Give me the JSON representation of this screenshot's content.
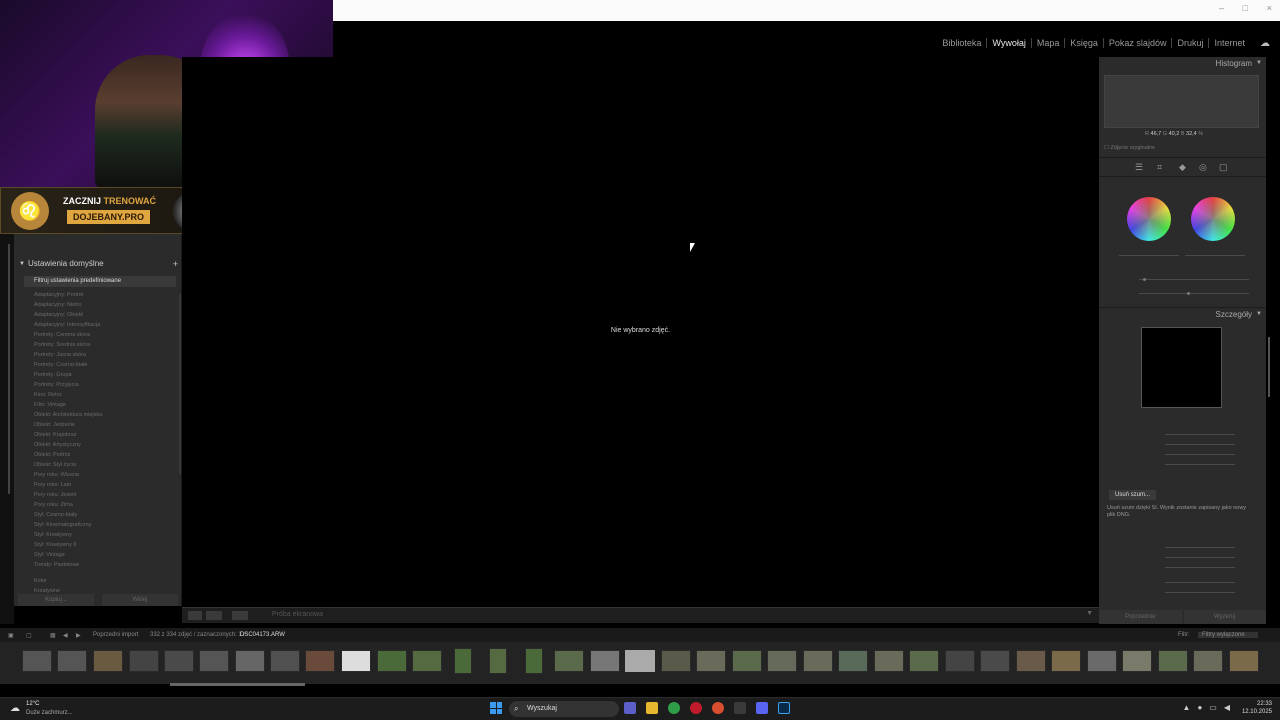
{
  "overlay": {
    "banner_line1_prefix": "ZACZNIJ",
    "banner_line1_accent": "TRENOWAĆ",
    "banner_line2": "DOJEBANY.PRO"
  },
  "window_controls": [
    "–",
    "□",
    "×"
  ],
  "modules": [
    "Biblioteka",
    "Wywołaj",
    "Mapa",
    "Księga",
    "Pokaz slajdów",
    "Drukuj",
    "Internet"
  ],
  "active_module": "Wywołaj",
  "left_panel": {
    "presets_header": "Ustawienia domyślne",
    "filter_label": "Filtruj ustawienia predefiniowane",
    "preset_groups": [
      "Adaptacyjny: Portret",
      "Adaptacyjny: Niebo",
      "Adaptacyjny: Obiekt",
      "Adaptacyjny: Intensyfikacja",
      "Portrety: Ciemna skóra",
      "Portrety: Średnia skóra",
      "Portrety: Jasna skóra",
      "Portrety: Czarno-białe",
      "Portrety: Grupa",
      "Portrety: Przyjęcia",
      "Kino: Retro",
      "Film: Vintage",
      "Obiekt: Architektura miejska",
      "Obiekt: Jedzenie",
      "Obiekt: Krajobraz",
      "Obiekt: Artystyczny",
      "Obiekt: Podróż",
      "Obiekt: Styl życia",
      "Pory roku: Wiosna",
      "Pory roku: Lato",
      "Pory roku: Jesień",
      "Pory roku: Zima",
      "Styl: Czarno-biały",
      "Styl: Kinematograficzny",
      "Styl: Kreatywny",
      "Styl: Kreatywny II",
      "Styl: Vintage",
      "Trendy: Pastelowe",
      "Kolor",
      "Kreatywne"
    ],
    "btn_import": "Kopiuj...",
    "btn_reset": "Wklej"
  },
  "center": {
    "message": "Nie wybrano zdjęć."
  },
  "toolbar": {
    "label": "Próba ekranowa"
  },
  "right_panel": {
    "histogram_title": "Histogram",
    "rgb": {
      "r_label": "R",
      "r": "46,7",
      "g_label": "G",
      "g": "40,2",
      "b_label": "B",
      "b": "32,4",
      "unit": "%"
    },
    "original_label": "Zdjęcie oryginalne",
    "details_title": "Szczegóły",
    "denoise_button": "Usuń szum...",
    "denoise_text": "Usuń szum dzięki SI. Wynik zostanie zapisany jako nowy plik DNG.",
    "btn_prev": "Poprzednie",
    "btn_reset": "Wyzeruj"
  },
  "filmstrip_bar": {
    "source": "Poprzedni import",
    "count": "332 z 334 zdjęć / zaznaczonych: 1 /",
    "filename": "DSC04173.ARW",
    "filter_label": "Filtr:",
    "filter_value": "Filtry wyłączone"
  },
  "taskbar": {
    "temperature": "12°C",
    "weather": "Duże zachmurz...",
    "search_placeholder": "Wyszukaj",
    "time": "22:33",
    "date": "12.10.2025"
  }
}
